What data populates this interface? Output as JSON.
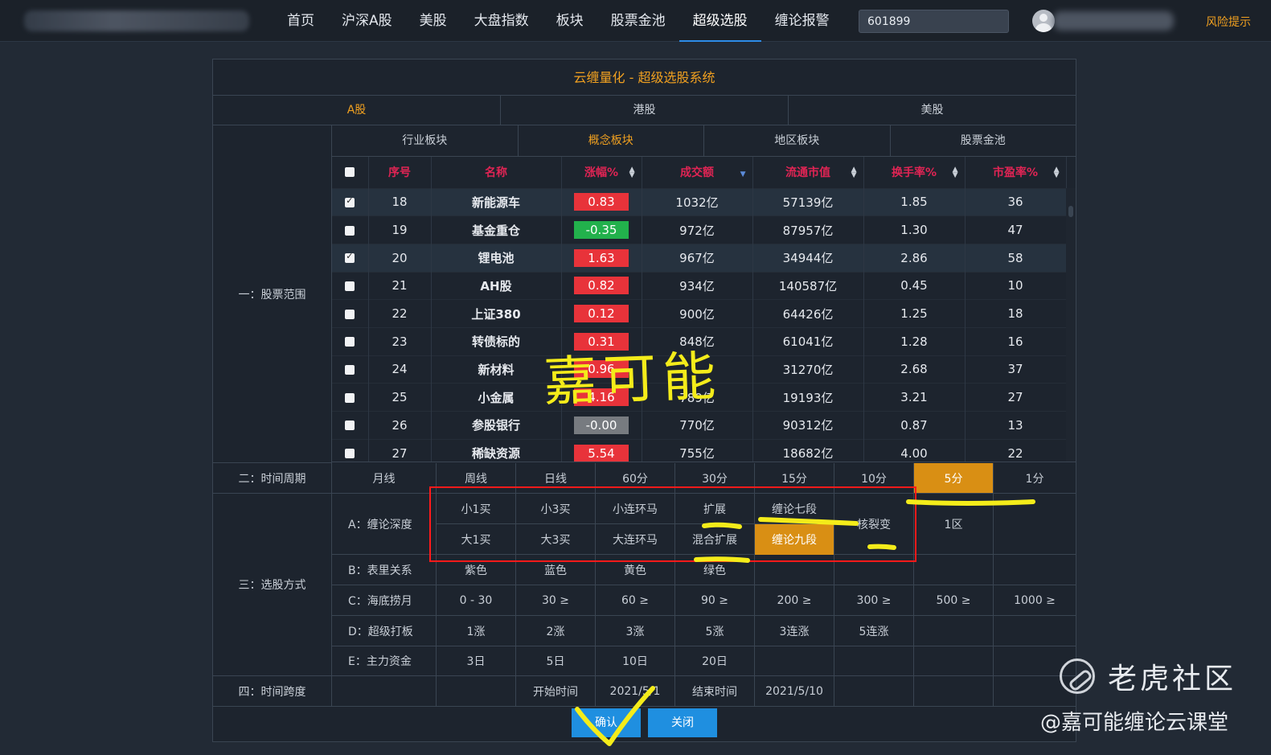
{
  "nav": {
    "items": [
      "首页",
      "沪深A股",
      "美股",
      "大盘指数",
      "板块",
      "股票金池",
      "超级选股",
      "缠论报警"
    ],
    "active": "超级选股",
    "search_value": "601899",
    "risk_label": "风险提示"
  },
  "panel": {
    "title": "云缠量化 - 超级选股系统",
    "markets": [
      "A股",
      "港股",
      "美股"
    ],
    "active_market": "A股",
    "sector_tabs": [
      "行业板块",
      "概念板块",
      "地区板块",
      "股票金池"
    ],
    "active_sector": "概念板块",
    "section1_label": "一：股票范围",
    "table": {
      "columns": [
        "序号",
        "名称",
        "涨幅%",
        "成交额",
        "流通市值",
        "换手率%",
        "市盈率%"
      ],
      "rows": [
        {
          "checked": true,
          "no": "18",
          "name": "新能源车",
          "chg": "0.83",
          "chg_color": "#e8333a",
          "amount": "1032亿",
          "mktcap": "57139亿",
          "turnover": "1.85",
          "pe": "36"
        },
        {
          "checked": false,
          "no": "19",
          "name": "基金重仓",
          "chg": "-0.35",
          "chg_color": "#22b14c",
          "amount": "972亿",
          "mktcap": "87957亿",
          "turnover": "1.30",
          "pe": "47"
        },
        {
          "checked": true,
          "no": "20",
          "name": "锂电池",
          "chg": "1.63",
          "chg_color": "#e8333a",
          "amount": "967亿",
          "mktcap": "34944亿",
          "turnover": "2.86",
          "pe": "58"
        },
        {
          "checked": false,
          "no": "21",
          "name": "AH股",
          "chg": "0.82",
          "chg_color": "#e8333a",
          "amount": "934亿",
          "mktcap": "140587亿",
          "turnover": "0.45",
          "pe": "10"
        },
        {
          "checked": false,
          "no": "22",
          "name": "上证380",
          "chg": "0.12",
          "chg_color": "#e8333a",
          "amount": "900亿",
          "mktcap": "64426亿",
          "turnover": "1.25",
          "pe": "18"
        },
        {
          "checked": false,
          "no": "23",
          "name": "转债标的",
          "chg": "0.31",
          "chg_color": "#e8333a",
          "amount": "848亿",
          "mktcap": "61041亿",
          "turnover": "1.28",
          "pe": "16"
        },
        {
          "checked": false,
          "no": "24",
          "name": "新材料",
          "chg": "0.96",
          "chg_color": "#e8333a",
          "amount": "",
          "mktcap": "31270亿",
          "turnover": "2.68",
          "pe": "37"
        },
        {
          "checked": false,
          "no": "25",
          "name": "小金属",
          "chg": "4.16",
          "chg_color": "#e8333a",
          "amount": "789亿",
          "mktcap": "19193亿",
          "turnover": "3.21",
          "pe": "27"
        },
        {
          "checked": false,
          "no": "26",
          "name": "参股银行",
          "chg": "-0.00",
          "chg_color": "#777b80",
          "amount": "770亿",
          "mktcap": "90312亿",
          "turnover": "0.87",
          "pe": "13"
        },
        {
          "checked": false,
          "no": "27",
          "name": "稀缺资源",
          "chg": "5.54",
          "chg_color": "#e8333a",
          "amount": "755亿",
          "mktcap": "18682亿",
          "turnover": "4.00",
          "pe": "22"
        }
      ]
    },
    "section2_label": "二：时间周期",
    "periods": [
      "月线",
      "周线",
      "日线",
      "60分",
      "30分",
      "15分",
      "10分",
      "5分",
      "1分"
    ],
    "active_period": "5分",
    "section3_label": "三：选股方式",
    "chanlun": {
      "label": "A：缠论深度",
      "row1": [
        "小1买",
        "小3买",
        "小连环马",
        "扩展",
        "缠论七段"
      ],
      "row2": [
        "大1买",
        "大3买",
        "大连环马",
        "混合扩展",
        "缠论九段"
      ],
      "merged": "核裂变",
      "extra": "1区",
      "active": "缠论九段"
    },
    "biaoli": {
      "label": "B：表里关系",
      "options": [
        "紫色",
        "蓝色",
        "黄色",
        "绿色"
      ]
    },
    "haidi": {
      "label": "C：海底捞月",
      "options": [
        "0 - 30",
        "30 ≥",
        "60 ≥",
        "90 ≥",
        "200 ≥",
        "300 ≥",
        "500 ≥",
        "1000 ≥"
      ]
    },
    "daban": {
      "label": "D：超级打板",
      "options": [
        "1涨",
        "2涨",
        "3涨",
        "5涨",
        "3连涨",
        "5连涨"
      ]
    },
    "zijin": {
      "label": "E：主力资金",
      "options": [
        "3日",
        "5日",
        "10日",
        "20日"
      ]
    },
    "section4_label": "四：时间跨度",
    "start_label": "开始时间",
    "start_value": "2021/5/1",
    "end_label": "结束时间",
    "end_value": "2021/5/10",
    "confirm_label": "确认",
    "close_label": "关闭"
  },
  "watermark": {
    "center_text": "嘉可能",
    "site_name": "老虎社区",
    "handle": "@嘉可能缠论云课堂",
    "annotation_color": "#f4ec1a",
    "box_color": "#ff1a1a"
  },
  "colors": {
    "accent": "#f0a020",
    "name": "#e020c8",
    "header": "#e02454",
    "selected": "#d98f14",
    "button": "#1f8fe0"
  }
}
